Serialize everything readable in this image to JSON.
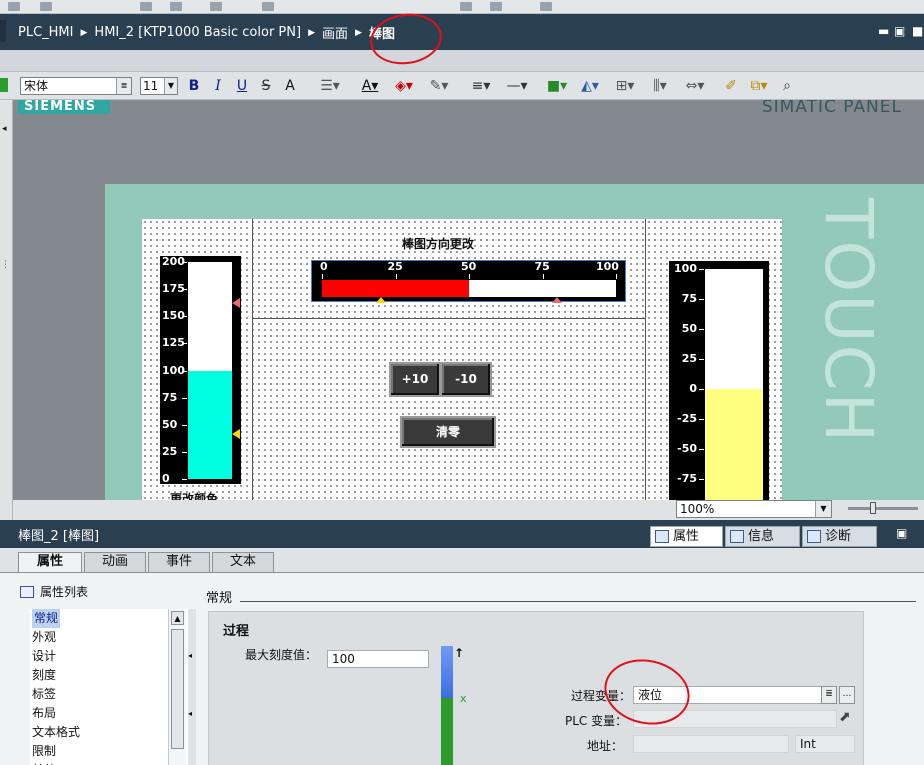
{
  "breadcrumb": {
    "items": [
      "PLC_HMI",
      "HMI_2 [KTP1000 Basic color PN]",
      "画面"
    ],
    "current": "棒图",
    "window_controls": [
      "▬",
      "▣",
      "■",
      "✕"
    ]
  },
  "format_toolbar": {
    "font": "宋体",
    "size": "11",
    "bold": "B",
    "italic": "I",
    "underline": "U",
    "strike": "S",
    "fontscale": "A"
  },
  "panel": {
    "brand": "SIEMENS",
    "model": "SIMATIC PANEL",
    "touch": "TOUCH"
  },
  "screen": {
    "left_bar": {
      "scale": [
        "200",
        "175",
        "150",
        "125",
        "100",
        "75",
        "50",
        "25",
        "0"
      ],
      "value_fraction": 0.5,
      "fill_color": "#00ffe0",
      "caption": "更改颜色"
    },
    "center": {
      "title": "棒图方向更改",
      "scale": [
        "0",
        "25",
        "50",
        "75",
        "100"
      ],
      "value_fraction": 0.5,
      "fill_color": "#ff0000"
    },
    "right_bar": {
      "scale": [
        "100",
        "75",
        "50",
        "25",
        "0",
        "-25",
        "-50",
        "-75"
      ],
      "fill_color": "#ffff80"
    },
    "buttons": {
      "plus10": "+10",
      "minus10": "-10",
      "clear": "清零"
    }
  },
  "zoom": {
    "value": "100%"
  },
  "properties": {
    "title": "棒图_2 [棒图]",
    "tabs": [
      "属性",
      "信息",
      "诊断"
    ],
    "subtabs": [
      "属性",
      "动画",
      "事件",
      "文本"
    ],
    "list_header": "属性列表",
    "list_items": [
      "常规",
      "外观",
      "设计",
      "刻度",
      "标签",
      "布局",
      "文本格式",
      "限制",
      "其他"
    ],
    "section": "常规",
    "group_title": "过程",
    "max_scale_label": "最大刻度值：",
    "max_scale_value": "100",
    "gauge_x_label": "x",
    "process_var_label": "过程变量：",
    "process_var_value": "液位",
    "plc_var_label": "PLC 变量：",
    "address_label": "地址：",
    "type_value": "Int"
  }
}
